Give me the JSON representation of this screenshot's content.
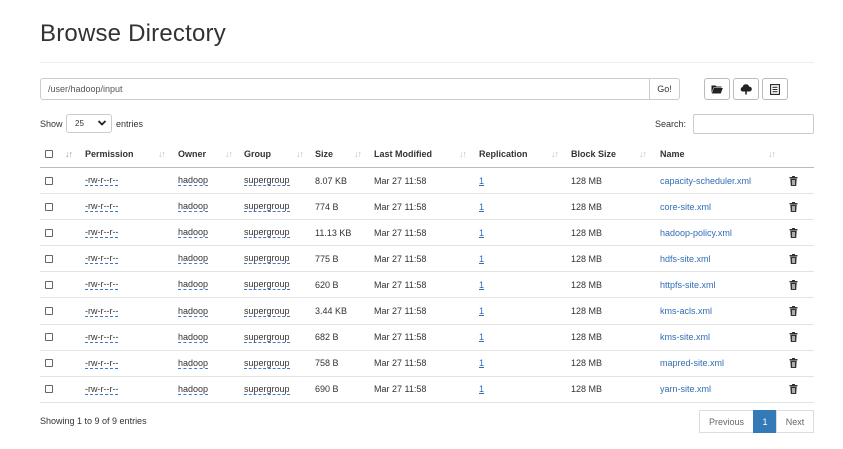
{
  "page": {
    "title": "Browse Directory"
  },
  "toolbar": {
    "path_value": "/user/hadoop/input",
    "go_label": "Go!",
    "icons": [
      "folder-icon",
      "upload-icon",
      "list-icon"
    ]
  },
  "controls": {
    "show_label": "Show",
    "entries_value": "25",
    "entries_label": "entries",
    "search_label": "Search:"
  },
  "table": {
    "headers": [
      "Permission",
      "Owner",
      "Group",
      "Size",
      "Last Modified",
      "Replication",
      "Block Size",
      "Name"
    ],
    "rows": [
      {
        "permission": "-rw-r--r--",
        "owner": "hadoop",
        "group": "supergroup",
        "size": "8.07 KB",
        "modified": "Mar 27 11:58",
        "replication": "1",
        "block_size": "128 MB",
        "name": "capacity-scheduler.xml"
      },
      {
        "permission": "-rw-r--r--",
        "owner": "hadoop",
        "group": "supergroup",
        "size": "774 B",
        "modified": "Mar 27 11:58",
        "replication": "1",
        "block_size": "128 MB",
        "name": "core-site.xml"
      },
      {
        "permission": "-rw-r--r--",
        "owner": "hadoop",
        "group": "supergroup",
        "size": "11.13 KB",
        "modified": "Mar 27 11:58",
        "replication": "1",
        "block_size": "128 MB",
        "name": "hadoop-policy.xml"
      },
      {
        "permission": "-rw-r--r--",
        "owner": "hadoop",
        "group": "supergroup",
        "size": "775 B",
        "modified": "Mar 27 11:58",
        "replication": "1",
        "block_size": "128 MB",
        "name": "hdfs-site.xml"
      },
      {
        "permission": "-rw-r--r--",
        "owner": "hadoop",
        "group": "supergroup",
        "size": "620 B",
        "modified": "Mar 27 11:58",
        "replication": "1",
        "block_size": "128 MB",
        "name": "httpfs-site.xml"
      },
      {
        "permission": "-rw-r--r--",
        "owner": "hadoop",
        "group": "supergroup",
        "size": "3.44 KB",
        "modified": "Mar 27 11:58",
        "replication": "1",
        "block_size": "128 MB",
        "name": "kms-acls.xml"
      },
      {
        "permission": "-rw-r--r--",
        "owner": "hadoop",
        "group": "supergroup",
        "size": "682 B",
        "modified": "Mar 27 11:58",
        "replication": "1",
        "block_size": "128 MB",
        "name": "kms-site.xml"
      },
      {
        "permission": "-rw-r--r--",
        "owner": "hadoop",
        "group": "supergroup",
        "size": "758 B",
        "modified": "Mar 27 11:58",
        "replication": "1",
        "block_size": "128 MB",
        "name": "mapred-site.xml"
      },
      {
        "permission": "-rw-r--r--",
        "owner": "hadoop",
        "group": "supergroup",
        "size": "690 B",
        "modified": "Mar 27 11:58",
        "replication": "1",
        "block_size": "128 MB",
        "name": "yarn-site.xml"
      }
    ]
  },
  "footer": {
    "info": "Showing 1 to 9 of 9 entries",
    "previous_label": "Previous",
    "current_page": "1",
    "next_label": "Next"
  },
  "colors": {
    "link": "#2f6db5",
    "active_page": "#337ab7"
  }
}
